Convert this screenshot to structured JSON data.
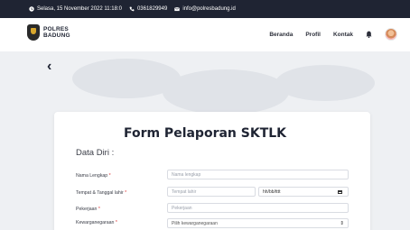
{
  "topbar": {
    "datetime": "Selasa, 15 November 2022 11:18:0",
    "phone": "0361829949",
    "email": "info@polresbadung.id"
  },
  "brand": {
    "line1": "POLRES",
    "line2": "BADUNG"
  },
  "nav": {
    "items": [
      "Beranda",
      "Profil",
      "Kontak"
    ],
    "bell_icon": "bell-icon"
  },
  "back_label": "‹",
  "form": {
    "title": "Form Pelaporan SKTLK",
    "section_title": "Data Diri :",
    "rows": [
      {
        "label": "Nama Lengkap",
        "placeholder": "Nama lengkap"
      },
      {
        "label": "Tempat & Tanggal lahir",
        "placeholder": "Tempat lahir",
        "date_placeholder": "hh/bb/tttt"
      },
      {
        "label": "Pekerjaan",
        "placeholder": "Pekerjaan"
      },
      {
        "label": "Kewarganegaraan",
        "placeholder": "Pilih kewarganegaraan"
      }
    ],
    "required_mark": "*"
  },
  "colors": {
    "topbar_bg": "#1f2433",
    "hero_bg": "#eef0f3",
    "required": "#dd3333"
  }
}
